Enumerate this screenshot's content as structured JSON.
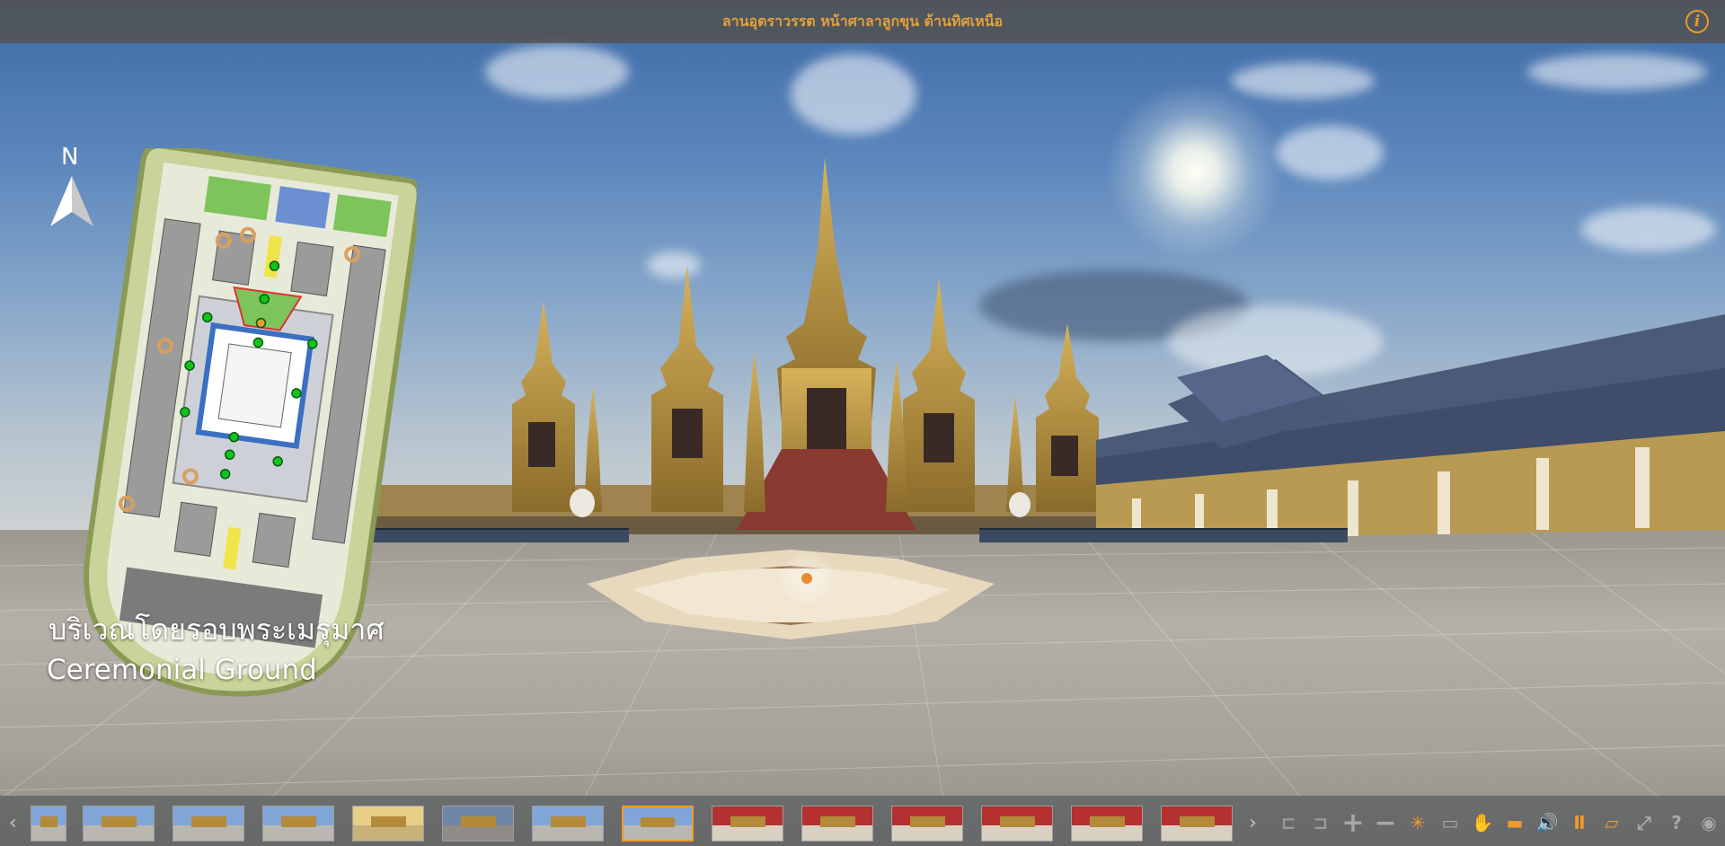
{
  "header": {
    "title": "ลานอุตราวรรต หน้าศาลาลูกขุน ด้านทิศเหนือ",
    "info_icon": "info-icon",
    "info_glyph": "i"
  },
  "map": {
    "north_label": "N",
    "place_name_th": "บริเวณโดยรอบพระเมรุมาศ",
    "place_name_en": "Ceremonial Ground"
  },
  "thumbnails": [
    {
      "kind": "day",
      "active": false
    },
    {
      "kind": "day",
      "active": false
    },
    {
      "kind": "day",
      "active": false
    },
    {
      "kind": "day",
      "active": false
    },
    {
      "kind": "sunset",
      "active": false
    },
    {
      "kind": "dusk",
      "active": false
    },
    {
      "kind": "day",
      "active": false
    },
    {
      "kind": "day",
      "active": true
    },
    {
      "kind": "interior",
      "active": false
    },
    {
      "kind": "interior",
      "active": false
    },
    {
      "kind": "interior",
      "active": false
    },
    {
      "kind": "interior",
      "active": false
    },
    {
      "kind": "interior",
      "active": false
    },
    {
      "kind": "interior",
      "active": false
    }
  ],
  "toolbar": {
    "prev_icon": "chevron-left-icon",
    "next_icon": "chevron-right-icon",
    "tools": [
      {
        "name": "previous-scene-icon",
        "color": "#9a9a9a"
      },
      {
        "name": "next-scene-icon",
        "color": "#9a9a9a"
      },
      {
        "name": "zoom-in-icon",
        "color": "#a8a8a8"
      },
      {
        "name": "zoom-out-icon",
        "color": "#a8a8a8"
      },
      {
        "name": "autorotate-icon",
        "color": "#f09a2a"
      },
      {
        "name": "vr-icon",
        "color": "#a8a8a8"
      },
      {
        "name": "hand-icon",
        "color": "#a8a8a8"
      },
      {
        "name": "gallery-icon",
        "color": "#f09a2a"
      },
      {
        "name": "sound-icon",
        "color": "#f09a2a"
      },
      {
        "name": "pause-icon",
        "color": "#f09a2a"
      },
      {
        "name": "map-icon",
        "color": "#f09a2a"
      },
      {
        "name": "fullscreen-icon",
        "color": "#a8a8a8"
      },
      {
        "name": "help-icon",
        "color": "#a8a8a8"
      },
      {
        "name": "about-icon",
        "color": "#a8a8a8"
      }
    ]
  },
  "colors": {
    "accent": "#f09a2a",
    "title": "#e2a03a",
    "map_green": "#11c41b"
  }
}
